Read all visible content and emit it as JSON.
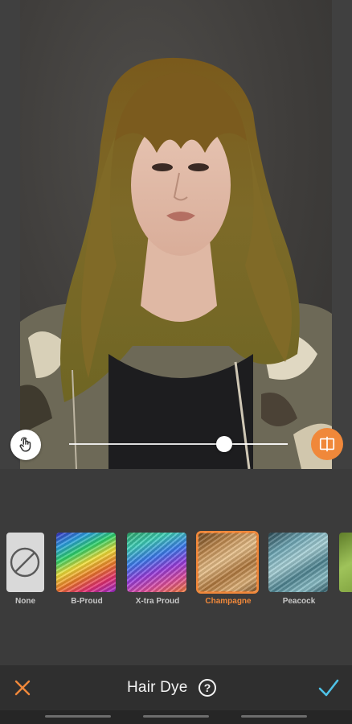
{
  "toolbar": {
    "title": "Hair Dye",
    "help_icon": "question-circle-icon",
    "close_icon": "close-x-icon",
    "confirm_icon": "checkmark-icon"
  },
  "slider": {
    "intensity_fraction": 0.71,
    "left_icon": "hand-touch-icon",
    "right_icon": "compare-split-icon"
  },
  "swatches": [
    {
      "label": "None",
      "style": "none",
      "selected": false
    },
    {
      "label": "B-Proud",
      "style": "rainbow",
      "selected": false
    },
    {
      "label": "X-tra Proud",
      "style": "rainbow2",
      "selected": false
    },
    {
      "label": "Champagne",
      "style": "champagne",
      "selected": true
    },
    {
      "label": "Peacock",
      "style": "peacock",
      "selected": false
    },
    {
      "label": "",
      "style": "green",
      "selected": false
    }
  ],
  "colors": {
    "accent": "#f0883a",
    "confirm": "#4fc3e8",
    "background": "#3b3b3b",
    "bar": "#2f2f2f"
  }
}
